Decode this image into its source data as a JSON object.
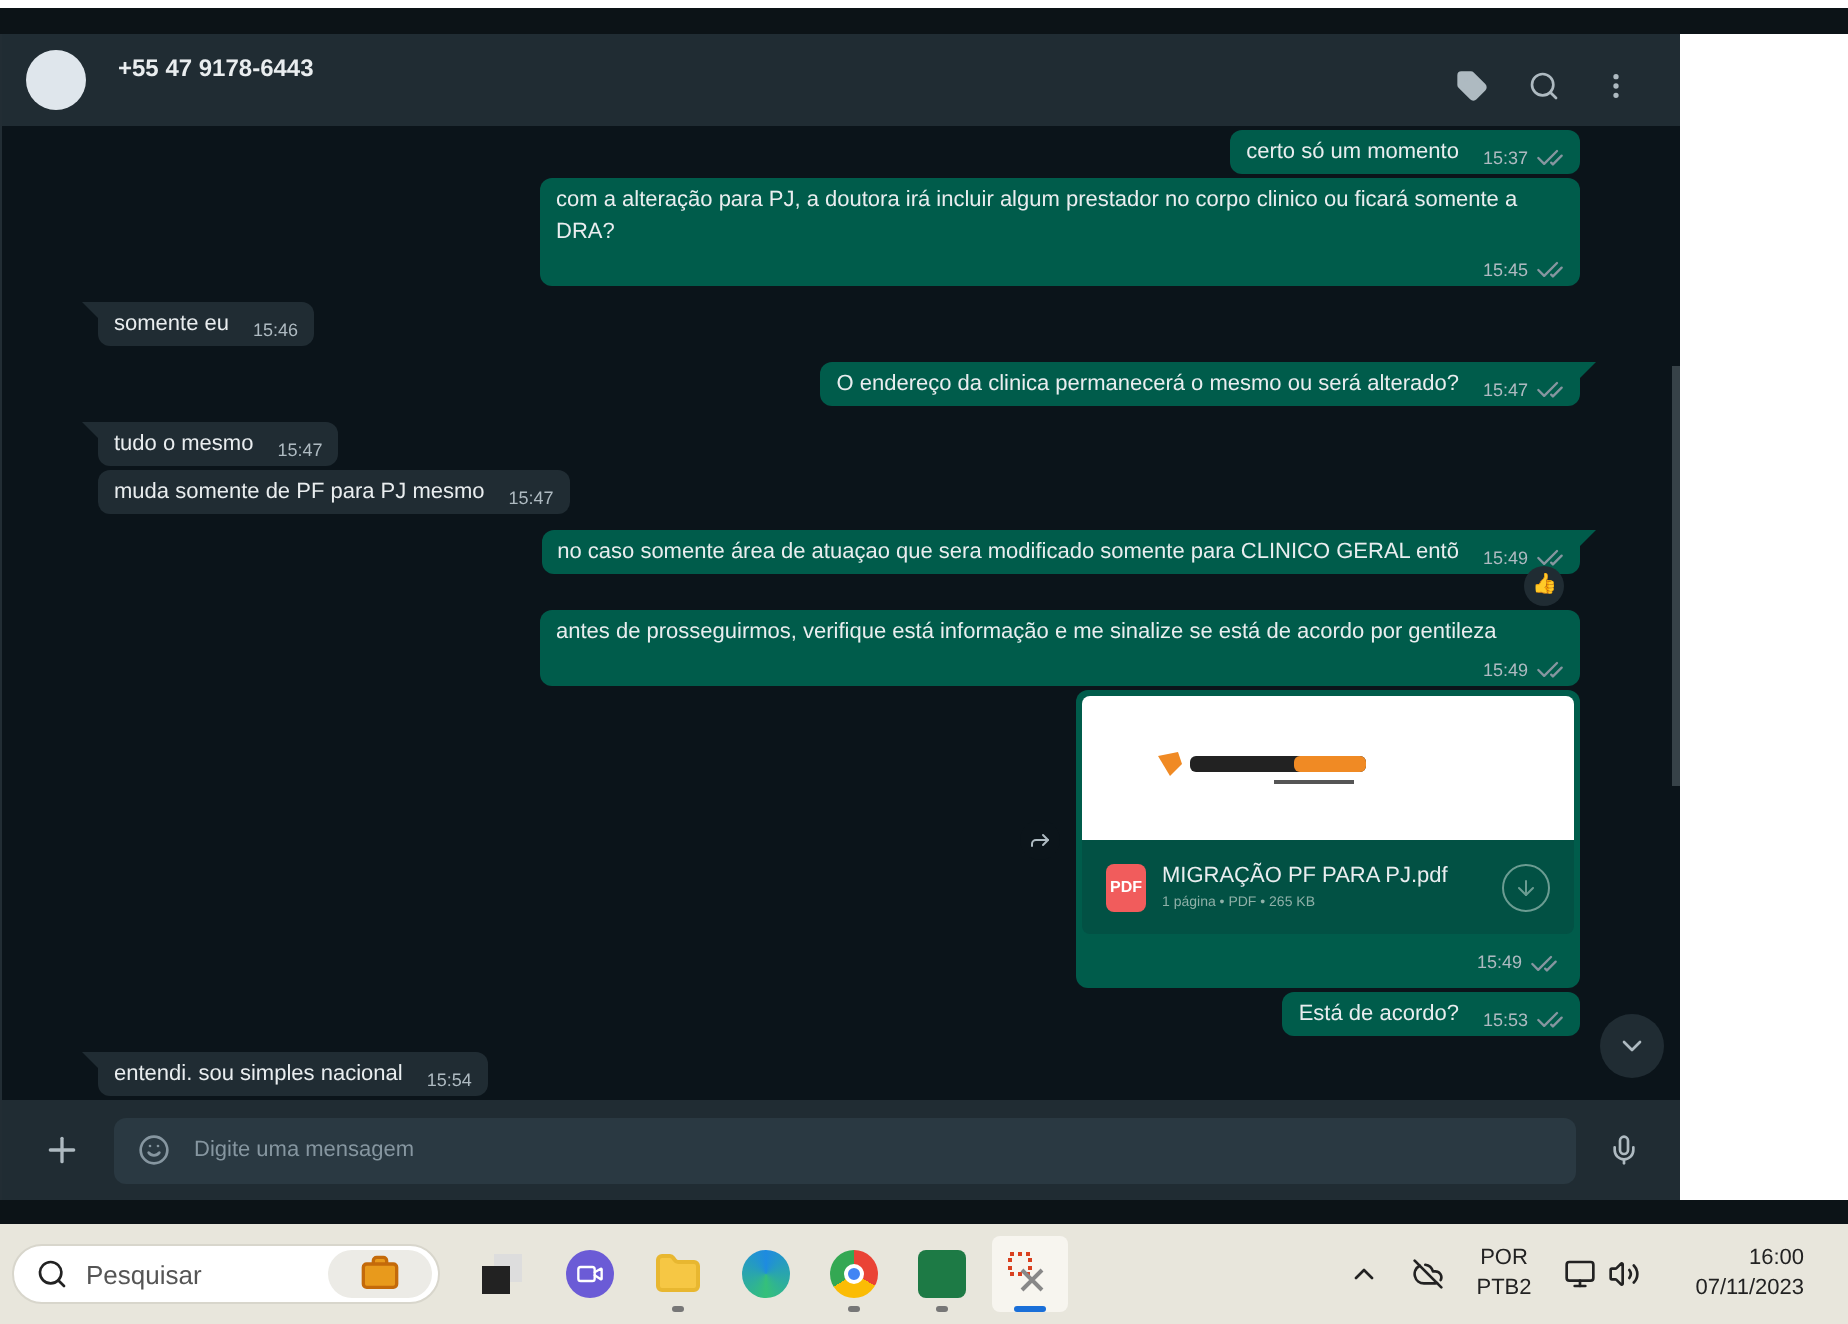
{
  "chat_header": {
    "contact": "+55 47 9178-6443"
  },
  "messages": [
    {
      "kind": "text",
      "outgoing": true,
      "text": "certo só um momento",
      "time": "15:37",
      "read": false,
      "tail": false
    },
    {
      "kind": "text",
      "outgoing": true,
      "text": "com a alteração para PJ, a doutora irá incluir algum prestador no corpo clinico ou ficará somente a DRA?",
      "time": "15:45",
      "read": false,
      "tail": false
    },
    {
      "kind": "text",
      "outgoing": false,
      "text": "somente eu",
      "time": "15:46",
      "tail": true
    },
    {
      "kind": "text",
      "outgoing": true,
      "text": "O endereço da clinica permanecerá o mesmo ou será alterado?",
      "time": "15:47",
      "read": false,
      "tail": true
    },
    {
      "kind": "text",
      "outgoing": false,
      "text": "tudo o mesmo",
      "time": "15:47",
      "tail": true
    },
    {
      "kind": "text",
      "outgoing": false,
      "text": "muda somente de PF para PJ mesmo",
      "time": "15:47",
      "tail": false
    },
    {
      "kind": "text",
      "outgoing": true,
      "text": "no caso somente área de atuaçao que sera modificado somente para CLINICO GERAL entõ",
      "time": "15:49",
      "read": false,
      "tail": true,
      "reaction": "👍"
    },
    {
      "kind": "text",
      "outgoing": true,
      "text": "antes de prosseguirmos, verifique está informação e me sinalize se está de acordo por gentileza",
      "time": "15:49",
      "read": false,
      "tail": false
    },
    {
      "kind": "document",
      "outgoing": true,
      "file_name": "MIGRAÇÃO PF PARA PJ.pdf",
      "file_type": "PDF",
      "meta": "1 página • PDF • 265 KB",
      "time": "15:49",
      "read": false
    },
    {
      "kind": "text",
      "outgoing": true,
      "text": "Está de acordo?",
      "time": "15:53",
      "read": false,
      "tail": false
    },
    {
      "kind": "text",
      "outgoing": false,
      "text": "entendi. sou simples nacional",
      "time": "15:54",
      "tail": true
    }
  ],
  "composer": {
    "placeholder": "Digite uma mensagem"
  },
  "taskbar": {
    "search": {
      "placeholder": "Pesquisar"
    },
    "apps": [
      {
        "kind": "taskview",
        "running": false,
        "active": false
      },
      {
        "kind": "meet",
        "running": false,
        "active": false
      },
      {
        "kind": "explorer",
        "running": true,
        "active": false
      },
      {
        "kind": "edge",
        "running": false,
        "active": false
      },
      {
        "kind": "chrome",
        "running": true,
        "active": false
      },
      {
        "kind": "excel",
        "running": true,
        "active": false
      },
      {
        "kind": "snip",
        "running": true,
        "active": true
      }
    ],
    "language": [
      "POR",
      "PTB2"
    ],
    "time": "16:00",
    "date": "07/11/2023"
  }
}
